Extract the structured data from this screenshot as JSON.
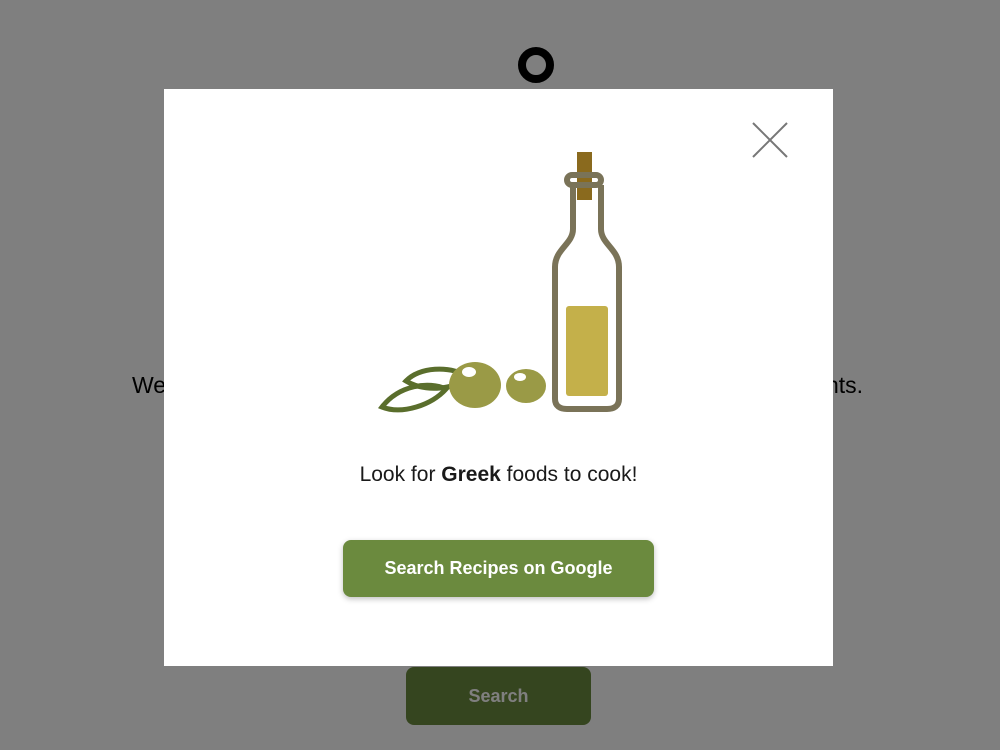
{
  "background": {
    "intro_text_start": "We",
    "intro_text_end": "nts.",
    "search_button_label": "Search"
  },
  "modal": {
    "prompt_before": "Look for ",
    "cuisine": "Greek",
    "prompt_after": " foods to cook!",
    "cta_label": "Search Recipes on Google",
    "close_icon": "close-x-icon",
    "illustration": "olive-oil-bottle-and-olives"
  },
  "colors": {
    "accent": "#6b8a3e",
    "overlay": "rgba(0,0,0,0.5)",
    "bottle_outline": "#7a7358",
    "oil": "#c4b04a",
    "cork": "#8a6a1e",
    "olive": "#9a9a46",
    "leaf": "#5a6e2c"
  }
}
